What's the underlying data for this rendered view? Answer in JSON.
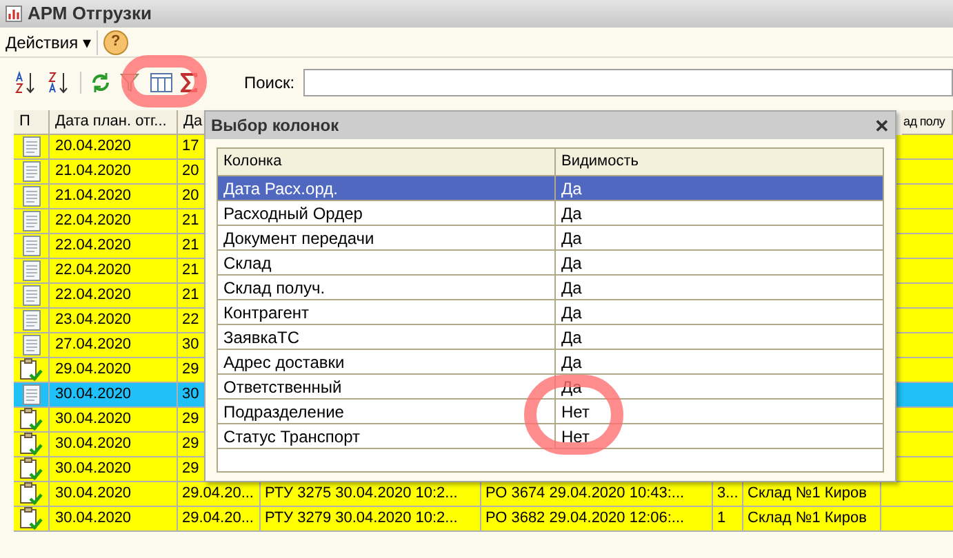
{
  "window": {
    "title": "АРМ Отгрузки"
  },
  "menu": {
    "actions": "Действия",
    "caret": "▾",
    "help": "?"
  },
  "search": {
    "label": "Поиск:"
  },
  "table": {
    "columns": [
      "П",
      "Дата план. отг...",
      "Да",
      "ад полу"
    ],
    "rows": [
      {
        "kind": "doc",
        "date": "20.04.2020",
        "column_3": "17",
        "selected": false
      },
      {
        "kind": "doc",
        "date": "21.04.2020",
        "column_3": "20",
        "selected": false
      },
      {
        "kind": "doc",
        "date": "21.04.2020",
        "column_3": "20",
        "selected": false
      },
      {
        "kind": "doc",
        "date": "22.04.2020",
        "column_3": "21",
        "selected": false
      },
      {
        "kind": "doc",
        "date": "22.04.2020",
        "column_3": "21",
        "selected": false
      },
      {
        "kind": "doc",
        "date": "22.04.2020",
        "column_3": "21",
        "selected": false
      },
      {
        "kind": "doc",
        "date": "22.04.2020",
        "column_3": "21",
        "selected": false
      },
      {
        "kind": "doc",
        "date": "23.04.2020",
        "column_3": "22",
        "selected": false
      },
      {
        "kind": "doc",
        "date": "27.04.2020",
        "column_3": "30",
        "selected": false
      },
      {
        "kind": "checked",
        "date": "29.04.2020",
        "column_3": "29",
        "selected": false
      },
      {
        "kind": "doc",
        "date": "30.04.2020",
        "column_3": "30",
        "selected": true
      },
      {
        "kind": "checked",
        "date": "30.04.2020",
        "column_3": "29",
        "selected": false
      },
      {
        "kind": "checked",
        "date": "30.04.2020",
        "column_3": "29",
        "selected": false
      },
      {
        "kind": "checked",
        "date": "30.04.2020",
        "column_3": "29",
        "selected": false
      },
      {
        "kind": "checked",
        "date": "30.04.2020",
        "column_3": "29.04.20...",
        "column_4": "РТУ 3275 30.04.2020 10:2...",
        "column_5": "РО 3674 29.04.2020 10:43:...",
        "column_6": "3...",
        "column_7": "Склад №1 Киров",
        "selected": false
      },
      {
        "kind": "checked",
        "date": "30.04.2020",
        "column_3": "29.04.20...",
        "column_4": "РТУ 3279 30.04.2020 10:2...",
        "column_5": "РО 3682 29.04.2020 12:06:...",
        "column_6": "1",
        "column_7": "Склад №1 Киров",
        "selected": false
      }
    ]
  },
  "dialog": {
    "title": "Выбор колонок",
    "close": "✕",
    "columns": [
      "Колонка",
      "Видимость"
    ],
    "rows": [
      {
        "name": "Дата Расх.орд.",
        "visibility": "Да",
        "selected": true
      },
      {
        "name": "Расходный Ордер",
        "visibility": "Да",
        "selected": false
      },
      {
        "name": "Документ передачи",
        "visibility": "Да",
        "selected": false
      },
      {
        "name": "Склад",
        "visibility": "Да",
        "selected": false
      },
      {
        "name": "Склад получ.",
        "visibility": "Да",
        "selected": false
      },
      {
        "name": "Контрагент",
        "visibility": "Да",
        "selected": false
      },
      {
        "name": "ЗаявкаТС",
        "visibility": "Да",
        "selected": false
      },
      {
        "name": "Адрес доставки",
        "visibility": "Да",
        "selected": false
      },
      {
        "name": "Ответственный",
        "visibility": "Да",
        "selected": false
      },
      {
        "name": "Подразделение",
        "visibility": "Нет",
        "selected": false
      },
      {
        "name": "Статус Транспорт",
        "visibility": "Нет",
        "selected": false
      }
    ]
  }
}
